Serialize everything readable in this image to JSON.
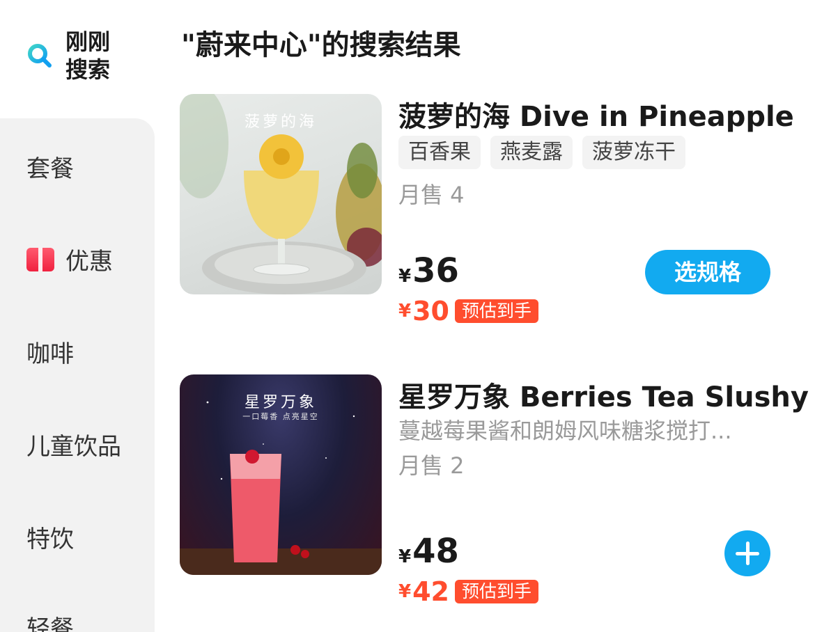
{
  "sidebar": {
    "recent_label": "刚刚\n搜索",
    "items": [
      {
        "label": "套餐"
      },
      {
        "label": "优惠",
        "icon": "coupon-icon"
      },
      {
        "label": "咖啡"
      },
      {
        "label": "儿童饮品"
      },
      {
        "label": "特饮"
      },
      {
        "label": "轻餐"
      }
    ]
  },
  "main": {
    "results_title": "\"蔚来中心\"的搜索结果",
    "products": [
      {
        "name": "菠萝的海 Dive in Pineapple",
        "image_caption": "菠萝的海",
        "tags": [
          "百香果",
          "燕麦露",
          "菠萝冻干"
        ],
        "sales": "月售 4",
        "currency": "¥",
        "price": "36",
        "est_price": "30",
        "est_label": "预估到手",
        "action_label": "选规格"
      },
      {
        "name": "星罗万象 Berries Tea Slushy",
        "image_caption": "星罗万象",
        "image_subcaption": "一口莓香 点亮星空",
        "description": "蔓越莓果酱和朗姆风味糖浆搅打...",
        "sales": "月售 2",
        "currency": "¥",
        "price": "48",
        "est_price": "42",
        "est_label": "预估到手",
        "action_icon": "plus-icon"
      }
    ]
  },
  "colors": {
    "accent": "#12aaf0",
    "price_red": "#ff4d2e",
    "sidebar_bg": "#f2f2f2"
  }
}
